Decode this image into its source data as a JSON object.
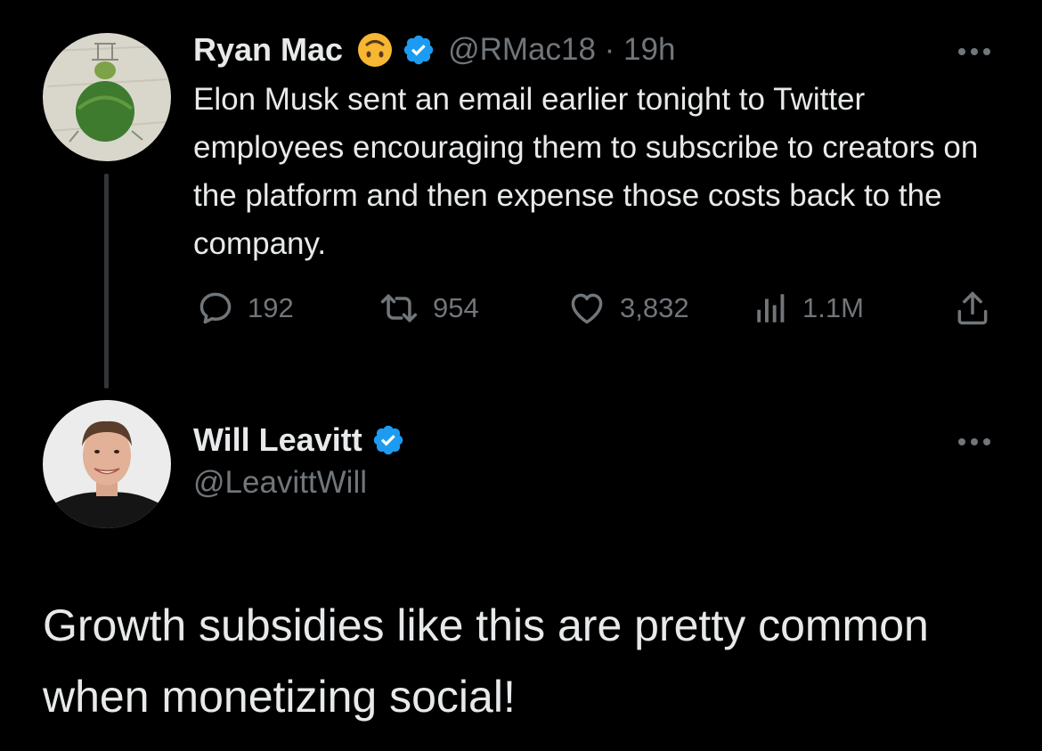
{
  "colors": {
    "background": "#000000",
    "text": "#e7e9ea",
    "muted": "#71767b",
    "verified": "#1d9bf0",
    "thread_line": "#333639"
  },
  "tweet1": {
    "name": "Ryan Mac",
    "emoji_icon": "upside-down-face-emoji",
    "handle": "@RMac18 · 19h",
    "text": "Elon Musk sent an email earlier tonight to Twitter employees encouraging them to subscribe to creators on the platform and then expense those costs back to the company.",
    "replies": "192",
    "retweets": "954",
    "likes": "3,832",
    "views": "1.1M"
  },
  "tweet2": {
    "name": "Will Leavitt",
    "handle": "@LeavittWill",
    "text": "Growth subsidies like this are pretty common when monetizing social!"
  },
  "icons": {
    "reply": "reply-icon",
    "retweet": "retweet-icon",
    "like": "heart-icon",
    "views": "views-icon",
    "share": "share-icon",
    "more": "more-icon",
    "verified": "verified-badge-icon"
  }
}
